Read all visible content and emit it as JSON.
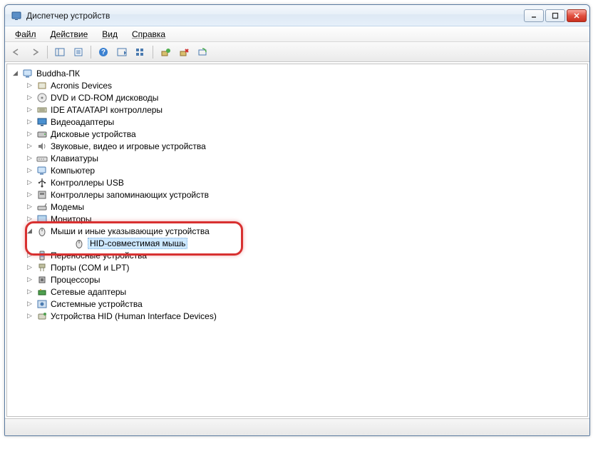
{
  "window": {
    "title": "Диспетчер устройств"
  },
  "menu": {
    "file": "Файл",
    "action": "Действие",
    "view": "Вид",
    "help": "Справка"
  },
  "tree": {
    "root": "Buddha-ПК",
    "categories": [
      {
        "label": "Acronis Devices"
      },
      {
        "label": "DVD и CD-ROM дисководы"
      },
      {
        "label": "IDE ATA/ATAPI контроллеры"
      },
      {
        "label": "Видеоадаптеры"
      },
      {
        "label": "Дисковые устройства"
      },
      {
        "label": "Звуковые, видео и игровые устройства"
      },
      {
        "label": "Клавиатуры"
      },
      {
        "label": "Компьютер"
      },
      {
        "label": "Контроллеры USB"
      },
      {
        "label": "Контроллеры запоминающих устройств"
      },
      {
        "label": "Модемы"
      },
      {
        "label": "Мониторы"
      },
      {
        "label": "Мыши и иные указывающие устройства",
        "expanded": true,
        "children": [
          {
            "label": "HID-совместимая мышь",
            "selected": true
          }
        ]
      },
      {
        "label": "Переносные устройства"
      },
      {
        "label": "Порты (COM и LPT)"
      },
      {
        "label": "Процессоры"
      },
      {
        "label": "Сетевые адаптеры"
      },
      {
        "label": "Системные устройства"
      },
      {
        "label": "Устройства HID (Human Interface Devices)"
      }
    ]
  },
  "icons": {
    "root": "computer",
    "0": "device",
    "1": "disc",
    "2": "ide",
    "3": "display",
    "4": "disk",
    "5": "sound",
    "6": "keyboard",
    "7": "computer",
    "8": "usb",
    "9": "storage",
    "10": "modem",
    "11": "monitor",
    "12": "mouse",
    "12.0": "mouse",
    "13": "portable",
    "14": "port",
    "15": "cpu",
    "16": "network",
    "17": "system",
    "18": "hid"
  }
}
